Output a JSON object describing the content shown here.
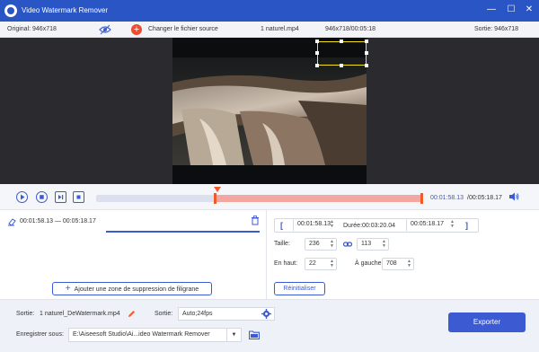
{
  "app": {
    "title": "Video Watermark Remover"
  },
  "window_controls": {
    "minimize": "—",
    "maximize": "☐",
    "close": "✕"
  },
  "topbar": {
    "original": "Original: 946x718",
    "change_source": "Changer le fichier source",
    "filename": "1 naturel.mp4",
    "info": "946x718/00:05:18",
    "output": "Sortie: 946x718"
  },
  "timeline": {
    "current_time": "00:01:58.13",
    "total_time": "/00:05:18.17"
  },
  "segments": [
    {
      "range": "00:01:58.13 — 00:05:18.17"
    }
  ],
  "add_zone_label": "Ajouter une zone de suppression de filigrane",
  "editor": {
    "start": "00:01:58.13",
    "duration": "Durée:00:03:20.04",
    "end": "00:05:18.17",
    "size_label": "Taille:",
    "width": "236",
    "height": "113",
    "top_label": "En haut:",
    "top": "22",
    "left_label": "À gauche:",
    "left": "708",
    "reset_label": "Réinitialiser"
  },
  "output": {
    "name_label": "Sortie:",
    "name": "1 naturel_DeWatermark.mp4",
    "format_label": "Sortie:",
    "format": "Auto;24fps",
    "save_label": "Enregistrer sous:",
    "path": "E:\\Aiseesoft Studio\\Ai...ideo Watermark Remover",
    "export_label": "Exporter"
  },
  "colors": {
    "accent": "#3c5bd2",
    "titlebar": "#2a55c5",
    "selection": "#f3a7a1",
    "marker": "#ef5a2b",
    "watermark_box": "#f4e21b"
  }
}
